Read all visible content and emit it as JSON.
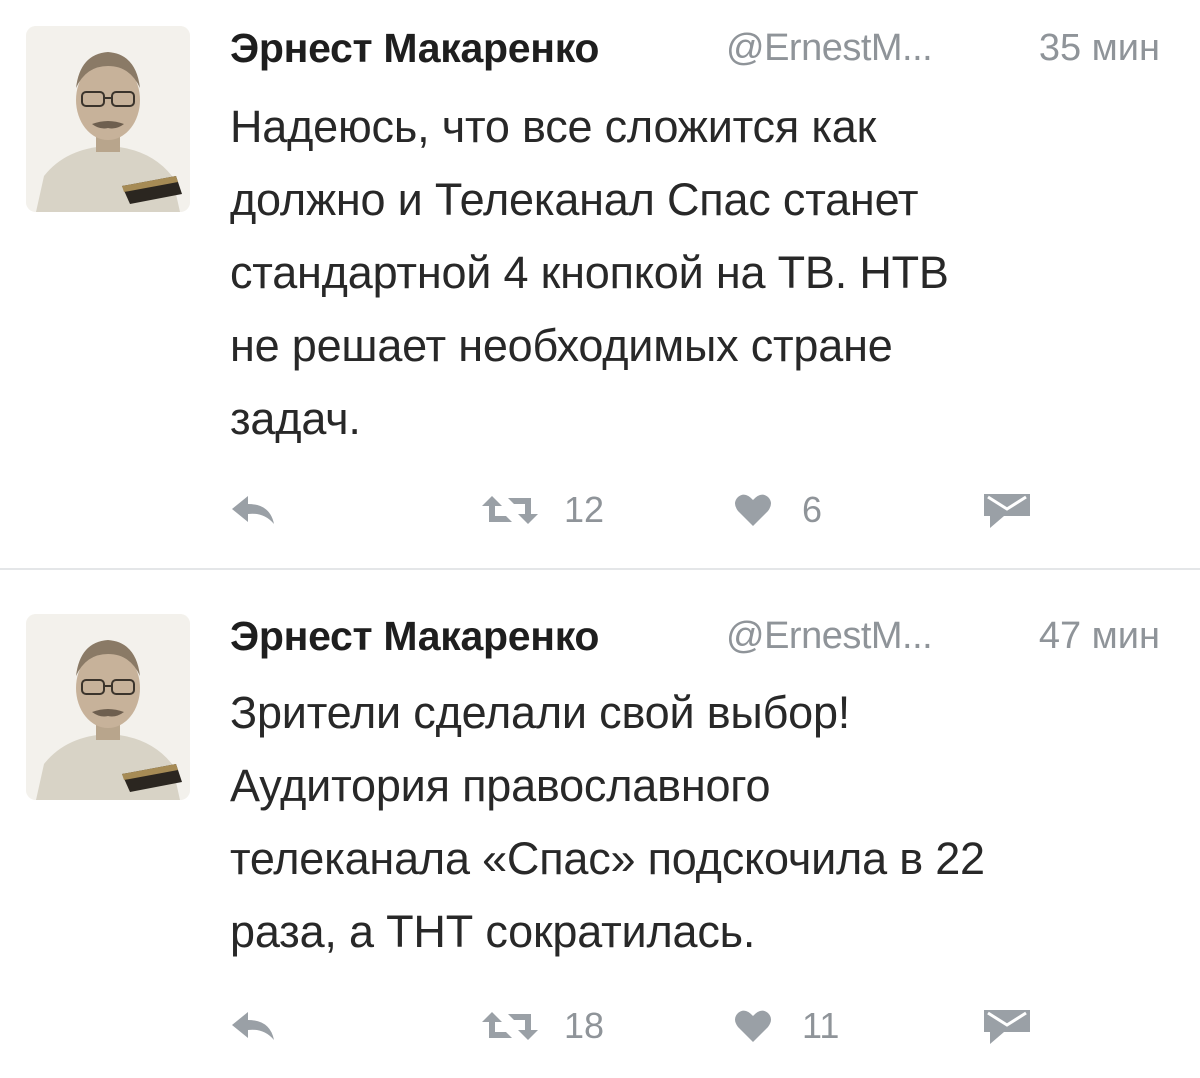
{
  "tweets": [
    {
      "author_name": "Эрнест Макаренко",
      "handle": "@ErnestM...",
      "time": "35 мин",
      "text": "Надеюсь, что все сложится как\nдолжно и Телеканал Спас станет\nстандартной 4 кнопкой на ТВ. НТВ\nне решает необходимых стране\nзадач.",
      "retweets": "12",
      "likes": "6"
    },
    {
      "author_name": "Эрнест Макаренко",
      "handle": "@ErnestM...",
      "time": "47 мин",
      "text": "Зрители сделали свой выбор!\nАудитория православного\nтелеканала «Спас» подскочила в 22\nраза, а ТНТ сократилась.",
      "retweets": "18",
      "likes": "11"
    }
  ],
  "icons": {
    "reply": "reply-icon",
    "retweet": "retweet-icon",
    "like": "heart-icon",
    "dm": "direct-message-icon"
  },
  "colors": {
    "text": "#282828",
    "muted": "#8f9499",
    "icon": "#9aa0a6",
    "divider": "#e4e6e8"
  }
}
